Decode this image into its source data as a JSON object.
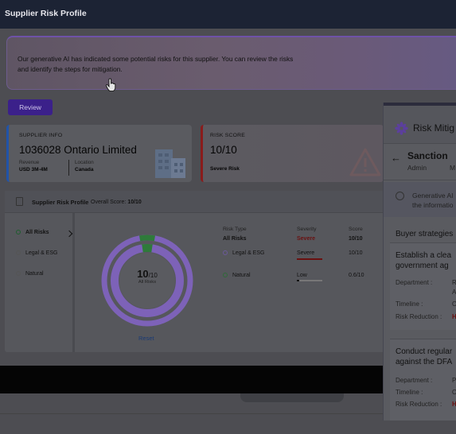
{
  "header": {
    "title": "Supplier Risk Profile"
  },
  "banner": {
    "message": "Our generative AI has indicated some potential risks for this supplier. You can review the risks and identify the steps for mitigation."
  },
  "review_label": "Review",
  "supplier_card": {
    "heading": "SUPPLIER INFO",
    "name": "1036028 Ontario Limited",
    "revenue_label": "Revenue",
    "revenue_value": "USD 3M-4M",
    "location_label": "Location",
    "location_value": "Canada",
    "icon": "building-icon"
  },
  "score_card": {
    "heading": "RISK SCORE",
    "value": "10/10",
    "label": "Severe Risk",
    "icon": "warning-icon"
  },
  "profile": {
    "title": "Supplier Risk Profile",
    "overall_label": "Overall Score:",
    "overall_value": "10/10",
    "risk_items": [
      {
        "label": "All Risks",
        "active": true
      },
      {
        "label": "Legal & ESG",
        "active": false
      },
      {
        "label": "Natural",
        "active": false
      }
    ],
    "donut": {
      "value": "10",
      "denominator": "/10",
      "sub": "All Risks",
      "score": 10,
      "max": 10
    },
    "reset_label": "Reset",
    "columns": {
      "risk_type": "Risk Type",
      "severity": "Severity",
      "score": "Score"
    },
    "rows": [
      {
        "type": "All Risks",
        "severity": "Severe",
        "score": "10/10"
      },
      {
        "type": "Legal & ESG",
        "severity": "Severe",
        "score": "10/10",
        "dot_color": "#6b5a9a"
      },
      {
        "type": "Natural",
        "severity": "Low",
        "score": "0.6/10",
        "dot_color": "#2f6a38"
      }
    ]
  },
  "drawer": {
    "title": "Risk Mitig",
    "sanction": "Sanction",
    "admin": "Admin",
    "admin_more": "M",
    "ai_text_1": "Generative AI",
    "ai_text_2": "the informatio",
    "buyer_heading": "Buyer strategies",
    "strategies": [
      {
        "title_1": "Establish a clea",
        "title_2": "government ag",
        "department_label": "Department :",
        "department_value_1": "R",
        "department_value_2": "A",
        "timeline_label": "Timeline :",
        "timeline_value": "O",
        "reduction_label": "Risk Reduction :",
        "reduction_value": "H"
      },
      {
        "title_1": "Conduct regular",
        "title_2": "against the DFA",
        "department_label": "Department :",
        "department_value_1": "P",
        "timeline_label": "Timeline :",
        "timeline_value": "O",
        "reduction_label": "Risk Reduction :",
        "reduction_value": "H"
      }
    ]
  },
  "colors": {
    "accent": "#3b208a",
    "severe": "#6a1010",
    "donut": "#7d62b8",
    "donut_segment": "#2f7a3a"
  }
}
